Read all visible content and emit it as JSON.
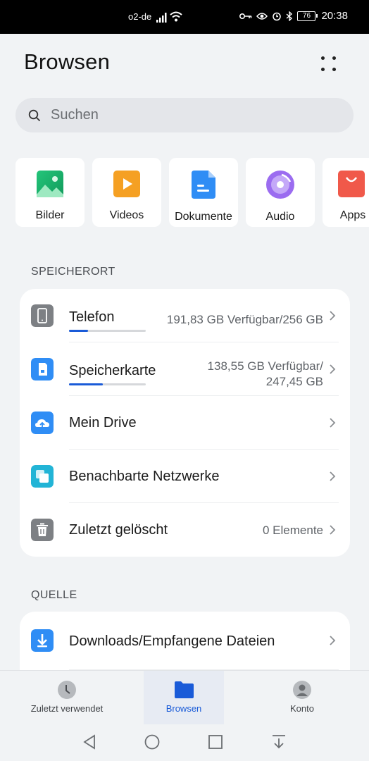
{
  "status_bar": {
    "carrier": "o2-de",
    "battery": "76",
    "time": "20:38"
  },
  "header": {
    "title": "Browsen"
  },
  "search": {
    "placeholder": "Suchen"
  },
  "categories": [
    {
      "label": "Bilder",
      "icon": "images-icon",
      "color": "#1fae6b"
    },
    {
      "label": "Videos",
      "icon": "video-icon",
      "color": "#f5a023"
    },
    {
      "label": "Dokumente",
      "icon": "document-icon",
      "color": "#2f8df5"
    },
    {
      "label": "Audio",
      "icon": "audio-icon",
      "color": "#9b6cf0"
    },
    {
      "label": "Apps",
      "icon": "apps-icon",
      "color": "#f0594a"
    }
  ],
  "storage": {
    "heading": "SPEICHERORT",
    "items": [
      {
        "label": "Telefon",
        "meta": "191,83 GB Verfügbar/256 GB",
        "usage": 0.25
      },
      {
        "label": "Speicherkarte",
        "meta_line1": "138,55 GB Verfügbar/",
        "meta_line2": "247,45 GB",
        "usage": 0.44
      },
      {
        "label": "Mein Drive"
      },
      {
        "label": "Benachbarte Netzwerke"
      },
      {
        "label": "Zuletzt gelöscht",
        "meta": "0 Elemente"
      }
    ]
  },
  "source": {
    "heading": "QUELLE",
    "items": [
      {
        "label": "Downloads/Empfangene Dateien"
      }
    ]
  },
  "bottom_nav": {
    "items": [
      {
        "label": "Zuletzt verwendet",
        "active": false
      },
      {
        "label": "Browsen",
        "active": true
      },
      {
        "label": "Konto",
        "active": false
      }
    ]
  },
  "colors": {
    "accent": "#1a5bd8",
    "background": "#f1f3f5"
  }
}
